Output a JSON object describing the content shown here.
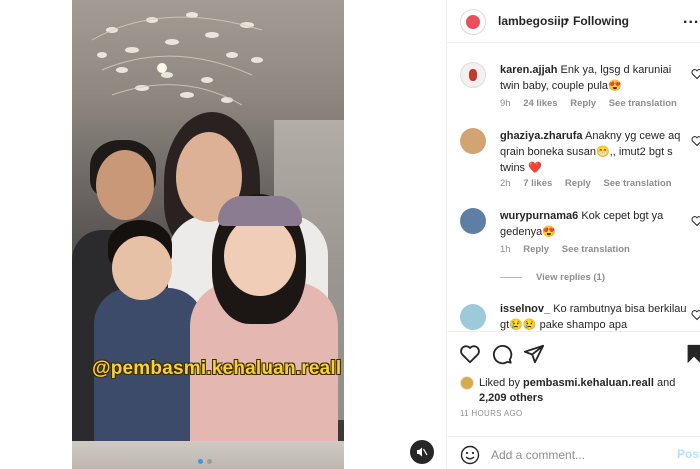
{
  "post": {
    "watermark": "@pembasmi.kehaluan.reall",
    "carousel_dots": 2,
    "active_dot": 1
  },
  "header": {
    "username": "lambegosiip",
    "separator": "•",
    "follow_status": "Following",
    "more": "..."
  },
  "comments": [
    {
      "username": "karen.ajjah",
      "text": "Enk ya, lgsg d karuniai twin baby, couple pula😍",
      "time": "9h",
      "likes": "24 likes",
      "reply": "Reply",
      "translate": "See translation"
    },
    {
      "username": "ghaziya.zharufa",
      "text": "Anakny yg cewe aq qrain boneka susan😁,, imut2 bgt s twins ❤️",
      "time": "2h",
      "likes": "7 likes",
      "reply": "Reply",
      "translate": "See translation"
    },
    {
      "username": "wurypurnama6",
      "text": "Kok cepet bgt ya gedenya😍",
      "time": "1h",
      "reply": "Reply",
      "translate": "See translation",
      "view_replies": "View replies (1)"
    },
    {
      "username": "isselnov_",
      "text": "Ko rambutnya bisa berkilau gt😢😢 pake shampo apa"
    }
  ],
  "likes": {
    "prefix": "Liked by",
    "user": "pembasmi.kehaluan.reall",
    "conjunction": "and",
    "others": "2,209 others"
  },
  "timestamp": "11 HOURS AGO",
  "add_comment": {
    "placeholder": "Add a comment...",
    "post_label": "Post"
  },
  "colors": {
    "link_blue": "#3897f0",
    "post_disabled": "#b2dffc",
    "meta_gray": "#8e8e8e",
    "watermark_yellow": "#f6d13a"
  },
  "icons": [
    "heart-icon",
    "comment-icon",
    "share-icon",
    "bookmark-icon",
    "emoji-icon",
    "mute-icon",
    "more-icon"
  ]
}
